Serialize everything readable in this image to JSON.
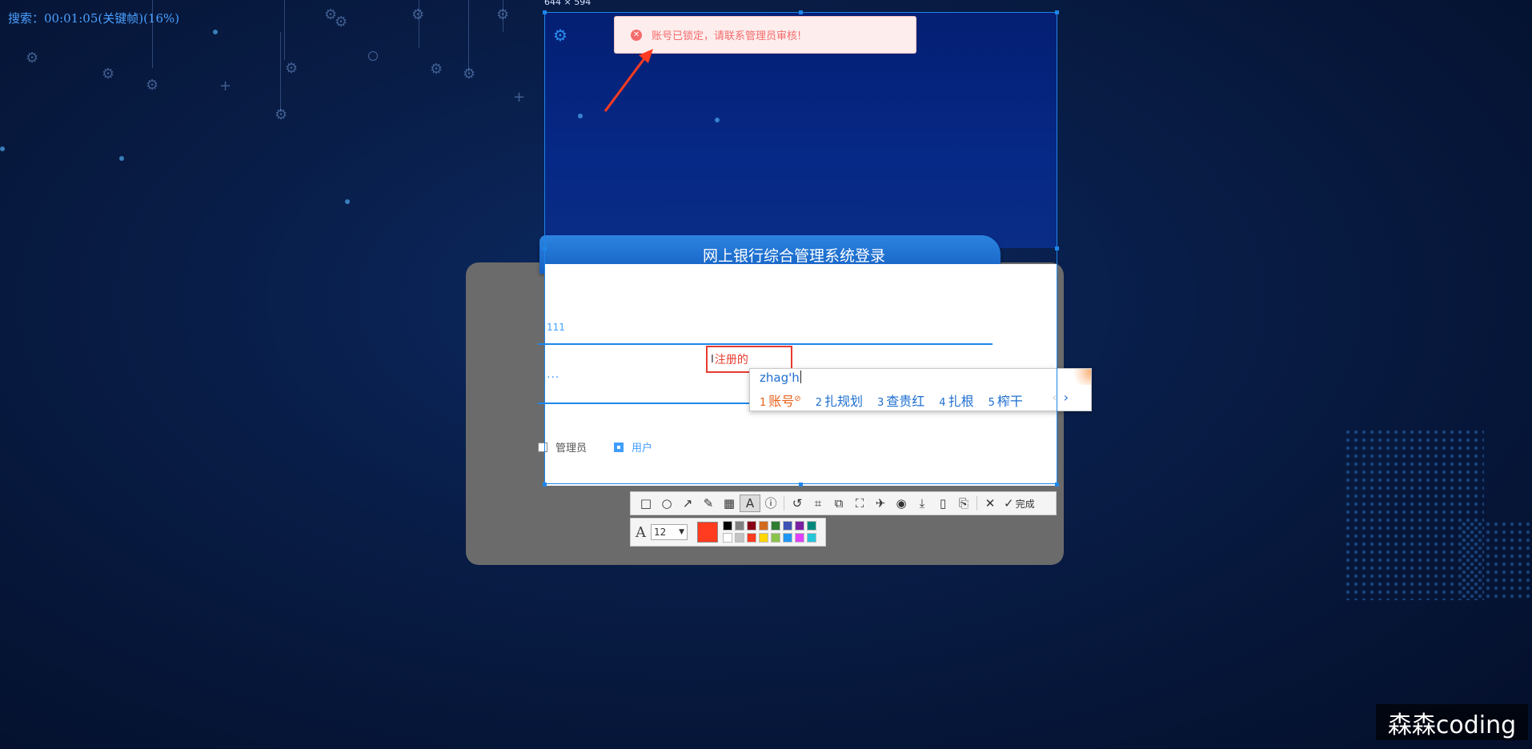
{
  "overlay": {
    "search_status": "搜索：00:01:05(关键帧)(16%)",
    "selection_size": "644 × 594"
  },
  "toast": {
    "message": "账号已锁定，请联系管理员审核!",
    "icon": "error-circle-icon",
    "color": "#f56c6c"
  },
  "login": {
    "title": "网上银行综合管理系统登录",
    "username_value": "111",
    "password_value": "···",
    "register_text": "注册的",
    "roles": [
      {
        "label": "管理员",
        "checked": false
      },
      {
        "label": "用户",
        "checked": true
      }
    ]
  },
  "ime": {
    "input": "zhag'h",
    "candidates": [
      {
        "num": "1",
        "text": "账号"
      },
      {
        "num": "2",
        "text": "扎规划"
      },
      {
        "num": "3",
        "text": "查贵红"
      },
      {
        "num": "4",
        "text": "扎根"
      },
      {
        "num": "5",
        "text": "榨干"
      }
    ],
    "prev": "‹",
    "next": "›"
  },
  "toolbar": {
    "tools": [
      {
        "name": "rectangle-tool-icon",
        "glyph": "□"
      },
      {
        "name": "ellipse-tool-icon",
        "glyph": "○"
      },
      {
        "name": "arrow-tool-icon",
        "glyph": "↗"
      },
      {
        "name": "pencil-tool-icon",
        "glyph": "✎"
      },
      {
        "name": "mosaic-tool-icon",
        "glyph": "▦"
      },
      {
        "name": "text-tool-icon",
        "glyph": "A",
        "active": true
      },
      {
        "name": "number-tool-icon",
        "glyph": "ⓘ"
      },
      {
        "name": "undo-icon",
        "glyph": "↺"
      },
      {
        "name": "ocr-icon",
        "glyph": "⌗"
      },
      {
        "name": "translate-icon",
        "glyph": "⧉"
      },
      {
        "name": "scroll-capture-icon",
        "glyph": "⛶"
      },
      {
        "name": "pin-icon",
        "glyph": "✈"
      },
      {
        "name": "record-icon",
        "glyph": "◉"
      },
      {
        "name": "download-icon",
        "glyph": "⤓"
      },
      {
        "name": "mobile-icon",
        "glyph": "▯"
      },
      {
        "name": "bookmark-icon",
        "glyph": "⎘"
      },
      {
        "name": "close-icon",
        "glyph": "✕"
      }
    ],
    "done_label": "完成"
  },
  "text_options": {
    "font_size": "12",
    "current_color": "#ff3b20",
    "palette": [
      "#000000",
      "#7f7f7f",
      "#880015",
      "#d2691e",
      "#2e7d32",
      "#3f51b5",
      "#7b1fa2",
      "#00897b",
      "#ffffff",
      "#c3c3c3",
      "#ff3b20",
      "#ffd600",
      "#8bc34a",
      "#2196f3",
      "#e040fb",
      "#26c6da"
    ]
  },
  "watermark": "森森coding"
}
